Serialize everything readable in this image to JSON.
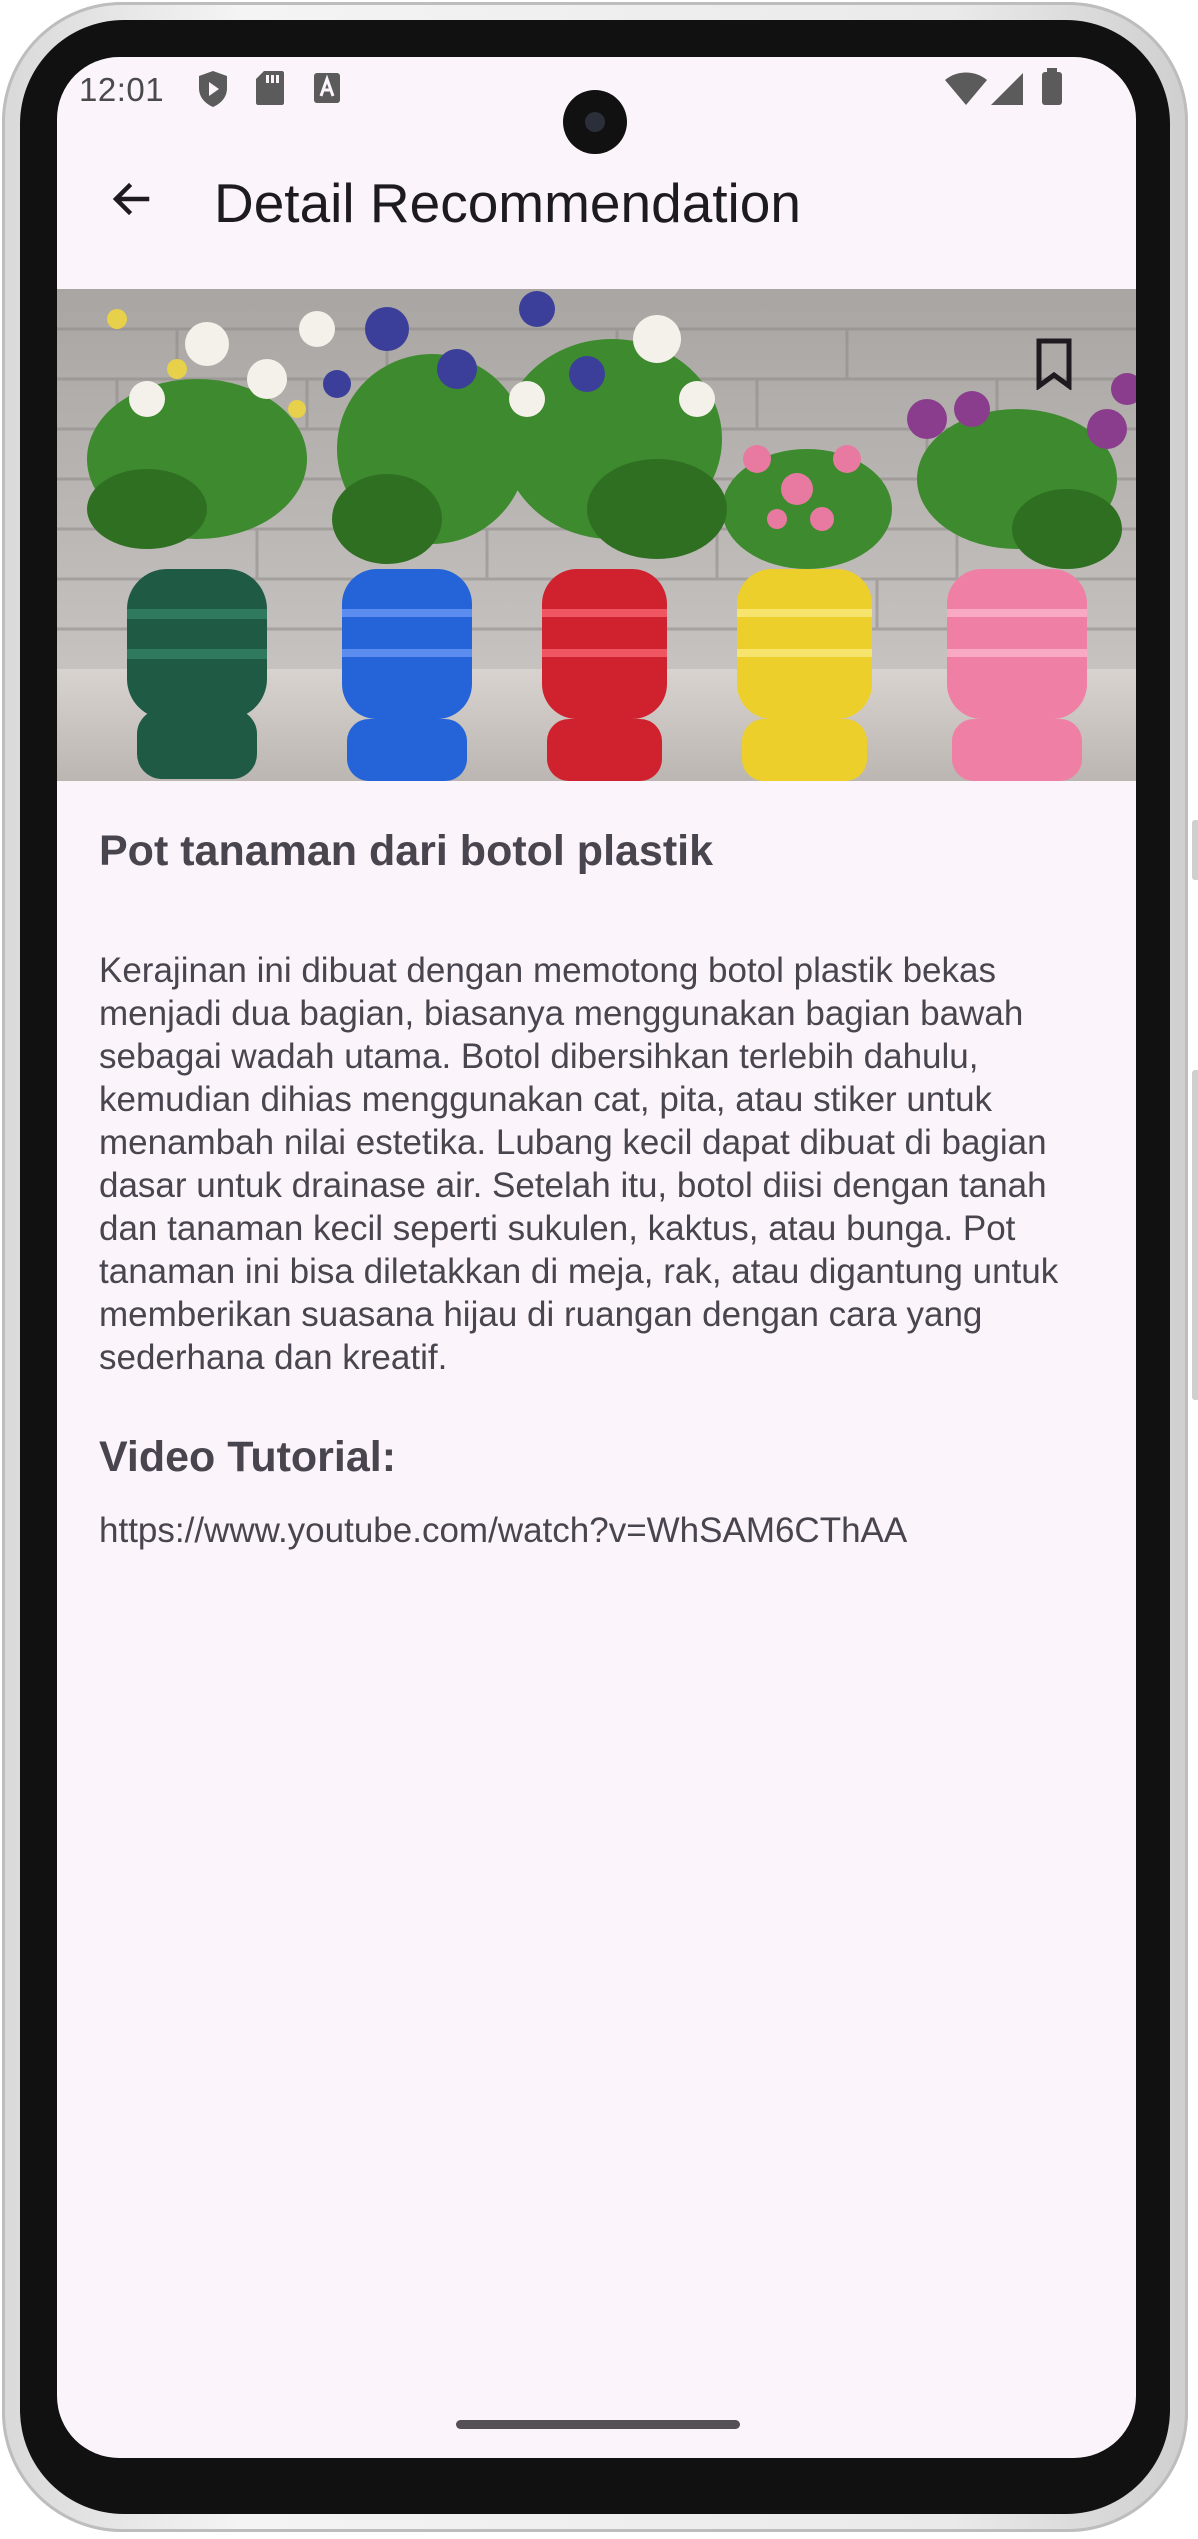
{
  "status_bar": {
    "time": "12:01",
    "left_icons": [
      "shield-play-icon",
      "sd-card-icon",
      "keyboard-a-icon"
    ],
    "right_icons": [
      "wifi-icon",
      "cellular-signal-icon",
      "battery-icon"
    ]
  },
  "app_bar": {
    "back_icon": "arrow-back-icon",
    "title": "Detail Recommendation"
  },
  "hero": {
    "image_description_icon": "plastic-bottle-planters-photo",
    "bookmark_icon": "bookmark-outline-icon",
    "pot_colors": [
      "#1f5a45",
      "#2563d9",
      "#d0222e",
      "#eccf2a",
      "#ef7fa4"
    ]
  },
  "detail": {
    "title": "Pot tanaman dari botol plastik",
    "description": "Kerajinan ini dibuat dengan memotong botol plastik bekas menjadi dua bagian, biasanya menggunakan bagian bawah sebagai wadah utama. Botol dibersihkan terlebih dahulu, kemudian dihias menggunakan cat, pita, atau stiker untuk menambah nilai estetika. Lubang kecil dapat dibuat di bagian dasar untuk drainase air. Setelah itu, botol diisi dengan tanah dan tanaman kecil seperti sukulen, kaktus, atau bunga. Pot tanaman ini bisa diletakkan di meja, rak, atau digantung untuk memberikan suasana hijau di ruangan dengan cara yang sederhana dan kreatif.",
    "video_heading": "Video Tutorial:",
    "video_url": "https://www.youtube.com/watch?v=WhSAM6CThAA"
  },
  "colors": {
    "background": "#fcf4fb",
    "text_primary": "#1d1b20",
    "text_secondary": "#49454f"
  }
}
